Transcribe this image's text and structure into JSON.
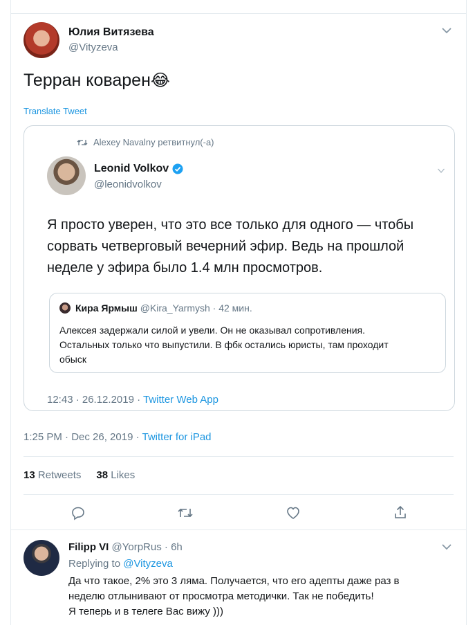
{
  "main_tweet": {
    "author_name": "Юлия Витязева",
    "author_handle": "@Vityzeva",
    "text": "Терран коварен",
    "emoji": "😂",
    "translate_label": "Translate Tweet",
    "retweet_context": "Alexey Navalny ретвитнул(-а)",
    "quoted": {
      "author_name": "Leonid Volkov",
      "author_handle": "@leonidvolkov",
      "text_lines": [
        "Я просто уверен, что это все только для одного — чтобы",
        "сорвать четверговый вечерний эфир. Ведь на прошлой",
        "неделе у эфира было 1.4 млн просмотров."
      ],
      "nested": {
        "author_name": "Кира Ярмыш",
        "author_handle": "@Kira_Yarmysh",
        "time": "· 42 мин.",
        "text_lines": [
          "Алексея задержали силой и увели. Он не оказывал сопротивления.",
          "Остальных только что выпустили. В фбк остались юристы, там проходит",
          "обыск"
        ]
      },
      "timestamp": "12:43 · 26.12.2019 · ",
      "source": "Twitter Web App"
    },
    "timestamp": "1:25 PM · Dec 26, 2019 · ",
    "source": "Twitter for iPad",
    "retweets_count": "13",
    "retweets_label": "Retweets",
    "likes_count": "38",
    "likes_label": "Likes"
  },
  "reply": {
    "author_name": "Filipp VI",
    "author_handle": "@YorpRus",
    "time": "· 6h",
    "replying_to_label": "Replying to ",
    "replying_to_handle": "@Vityzeva",
    "text_lines": [
      "Да что такое, 2% это 3 ляма. Получается, что его адепты даже раз в",
      "неделю отлынивают от просмотра методички. Так не победить!",
      "Я теперь и в телеге Вас вижу )))"
    ]
  },
  "icons": [
    "chevron-down-icon",
    "retweet-icon",
    "verified-badge-icon",
    "reply-icon",
    "like-icon",
    "share-icon"
  ],
  "colors": {
    "link": "#1b95e0",
    "secondary": "#657786",
    "border": "#e6ecf0",
    "verified": "#1da1f2"
  }
}
